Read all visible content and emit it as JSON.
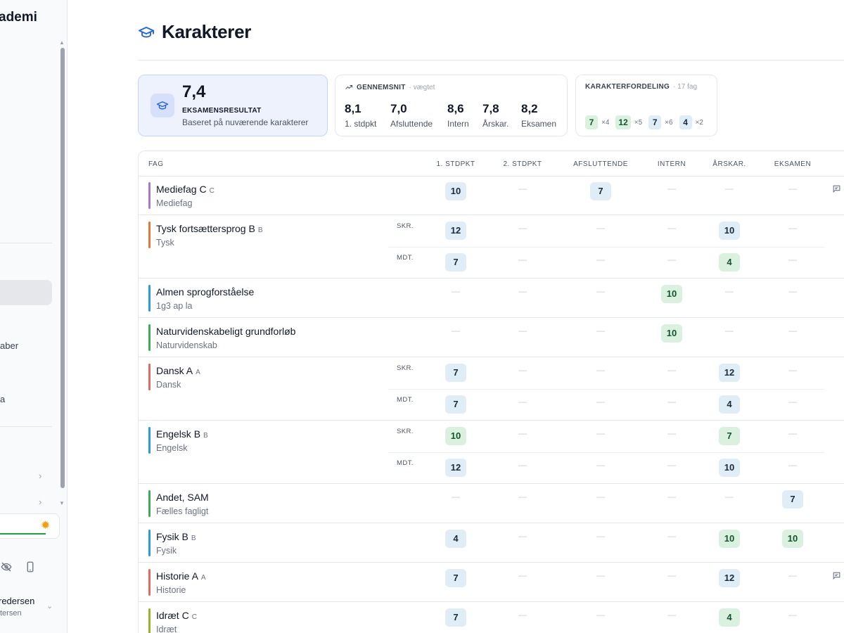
{
  "sidebar": {
    "brand": "ademi",
    "items": [
      {
        "label": "aber"
      },
      {
        "label": "a"
      }
    ],
    "user": {
      "name": "redersen",
      "sub": "tersen"
    }
  },
  "header": {
    "title": "Karakterer"
  },
  "summary": {
    "exam": {
      "value": "7,4",
      "label": "EKSAMENSRESULTAT",
      "sub": "Baseret på nuværende karakterer"
    },
    "average": {
      "heading": "GENNEMSNIT",
      "subheading": "· vægtet",
      "stats": [
        {
          "value": "8,1",
          "label": "1. stdpkt"
        },
        {
          "value": "7,0",
          "label": "Afsluttende"
        },
        {
          "value": "8,6",
          "label": "Intern"
        },
        {
          "value": "7,8",
          "label": "Årskar."
        },
        {
          "value": "8,2",
          "label": "Eksamen"
        }
      ]
    },
    "distribution": {
      "heading": "KARAKTERFORDELING",
      "subheading": "· 17 fag",
      "items": [
        {
          "grade": "7",
          "count": "×4",
          "color": "green"
        },
        {
          "grade": "12",
          "count": "×5",
          "color": "green"
        },
        {
          "grade": "7",
          "count": "×6",
          "color": "blue"
        },
        {
          "grade": "4",
          "count": "×2",
          "color": "blue"
        }
      ]
    }
  },
  "table": {
    "columns": [
      "FAG",
      "1. STDPKT",
      "2. STDPKT",
      "AFSLUTTENDE",
      "INTERN",
      "ÅRSKAR.",
      "EKSAMEN"
    ],
    "dash": "—",
    "rows": [
      {
        "name": "Mediefag C",
        "level": "C",
        "sub": "Mediefag",
        "bar": "#a779c9",
        "comment": true,
        "lines": [
          {
            "type": "",
            "grades": [
              {
                "v": "10",
                "c": "blue"
              },
              null,
              {
                "v": "7",
                "c": "blue"
              },
              null,
              null,
              null
            ]
          }
        ]
      },
      {
        "name": "Tysk fortsættersprog B",
        "level": "B",
        "sub": "Tysk",
        "bar": "#e07a3a",
        "comment": false,
        "lines": [
          {
            "type": "SKR.",
            "grades": [
              {
                "v": "12",
                "c": "blue"
              },
              null,
              null,
              null,
              {
                "v": "10",
                "c": "blue"
              },
              null
            ]
          },
          {
            "type": "MDT.",
            "grades": [
              {
                "v": "7",
                "c": "blue"
              },
              null,
              null,
              null,
              {
                "v": "4",
                "c": "green"
              },
              null
            ]
          }
        ]
      },
      {
        "name": "Almen sprogforståelse",
        "level": "",
        "sub": "1g3 ap la",
        "bar": "#2d9bd6",
        "comment": false,
        "lines": [
          {
            "type": "",
            "grades": [
              null,
              null,
              null,
              {
                "v": "10",
                "c": "green"
              },
              null,
              null
            ]
          }
        ]
      },
      {
        "name": "Naturvidenskabeligt grundforløb",
        "level": "",
        "sub": "Naturvidenskab",
        "bar": "#3faa5c",
        "comment": false,
        "lines": [
          {
            "type": "",
            "grades": [
              null,
              null,
              null,
              {
                "v": "10",
                "c": "green"
              },
              null,
              null
            ]
          }
        ]
      },
      {
        "name": "Dansk A",
        "level": "A",
        "sub": "Dansk",
        "bar": "#e06a64",
        "comment": false,
        "lines": [
          {
            "type": "SKR.",
            "grades": [
              {
                "v": "7",
                "c": "blue"
              },
              null,
              null,
              null,
              {
                "v": "12",
                "c": "blue"
              },
              null
            ]
          },
          {
            "type": "MDT.",
            "grades": [
              {
                "v": "7",
                "c": "blue"
              },
              null,
              null,
              null,
              {
                "v": "4",
                "c": "blue"
              },
              null
            ]
          }
        ]
      },
      {
        "name": "Engelsk B",
        "level": "B",
        "sub": "Engelsk",
        "bar": "#2d9bd6",
        "comment": false,
        "lines": [
          {
            "type": "SKR.",
            "grades": [
              {
                "v": "10",
                "c": "green"
              },
              null,
              null,
              null,
              {
                "v": "7",
                "c": "green"
              },
              null
            ]
          },
          {
            "type": "MDT.",
            "grades": [
              {
                "v": "12",
                "c": "blue"
              },
              null,
              null,
              null,
              {
                "v": "10",
                "c": "blue"
              },
              null
            ]
          }
        ]
      },
      {
        "name": "Andet, SAM",
        "level": "",
        "sub": "Fælles fagligt",
        "bar": "#3faa5c",
        "comment": false,
        "lines": [
          {
            "type": "",
            "grades": [
              null,
              null,
              null,
              null,
              null,
              {
                "v": "7",
                "c": "blue"
              }
            ]
          }
        ]
      },
      {
        "name": "Fysik B",
        "level": "B",
        "sub": "Fysik",
        "bar": "#2d9bd6",
        "comment": false,
        "lines": [
          {
            "type": "",
            "grades": [
              {
                "v": "4",
                "c": "blue"
              },
              null,
              null,
              null,
              {
                "v": "10",
                "c": "green"
              },
              {
                "v": "10",
                "c": "green"
              }
            ]
          }
        ]
      },
      {
        "name": "Historie A",
        "level": "A",
        "sub": "Historie",
        "bar": "#e06a64",
        "comment": true,
        "lines": [
          {
            "type": "",
            "grades": [
              {
                "v": "7",
                "c": "blue"
              },
              null,
              null,
              null,
              {
                "v": "12",
                "c": "blue"
              },
              null
            ]
          }
        ]
      },
      {
        "name": "Idræt C",
        "level": "C",
        "sub": "Idræt",
        "bar": "#9cb22e",
        "comment": false,
        "lines": [
          {
            "type": "",
            "grades": [
              {
                "v": "7",
                "c": "blue"
              },
              null,
              null,
              null,
              {
                "v": "4",
                "c": "green"
              },
              null
            ]
          }
        ]
      }
    ]
  }
}
